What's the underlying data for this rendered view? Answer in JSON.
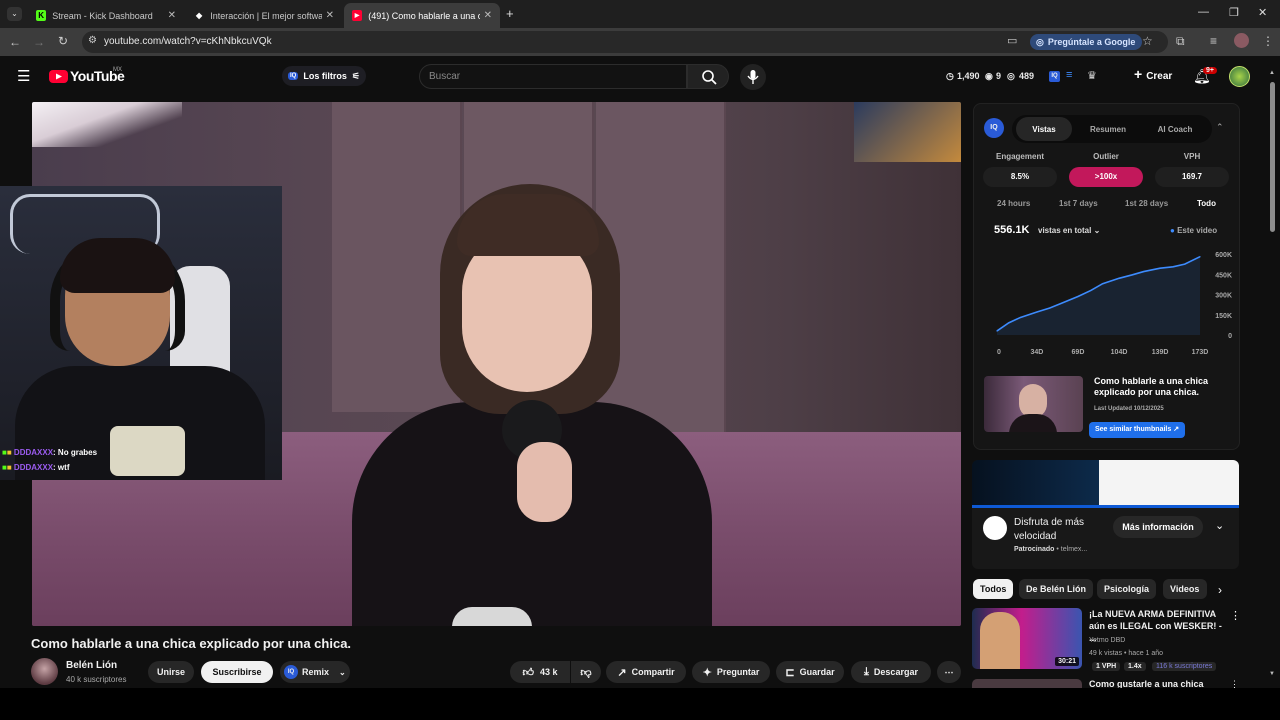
{
  "browser": {
    "tabs": [
      {
        "title": "Stream - Kick Dashboard",
        "favicon": "K",
        "color": "#53fc18",
        "active": false
      },
      {
        "title": "Interacción | El mejor software pa",
        "favicon": "◆",
        "color": "#ffffff",
        "active": false
      },
      {
        "title": "(491) Como hablarle a una chic",
        "favicon": "▶",
        "color": "#ff0033",
        "active": true
      }
    ],
    "url": "youtube.com/watch?v=cKhNbkcuVQk",
    "ask_google": "Pregúntale a Google"
  },
  "youtube": {
    "logo_text": "YouTube",
    "region": "MX",
    "filters_label": "Los filtros",
    "search_placeholder": "Buscar",
    "stats": [
      "1,490",
      "9",
      "489"
    ],
    "create_label": "Crear",
    "notif_count": "9+"
  },
  "video": {
    "title": "Como hablarle a una chica explicado por una chica.",
    "chat": [
      {
        "user": "DDDAXXX",
        "message": ": No grabes"
      },
      {
        "user": "DDDAXXX",
        "message": ": wtf"
      }
    ]
  },
  "channel": {
    "name": "Belén Lión",
    "subscribers": "40 k suscriptores",
    "join_label": "Unirse",
    "subscribe_label": "Suscribirse",
    "remix_label": "Remix"
  },
  "actions": {
    "likes": "43 k",
    "share": "Compartir",
    "ask": "Preguntar",
    "save": "Guardar",
    "download": "Descargar"
  },
  "iq_panel": {
    "tabs": [
      "Vistas",
      "Resumen",
      "AI Coach"
    ],
    "active_tab": "Vistas",
    "metrics": [
      {
        "label": "Engagement",
        "value": "8.5%"
      },
      {
        "label": "Outlier",
        "value": ">100x"
      },
      {
        "label": "VPH",
        "value": "169.7"
      }
    ],
    "ranges": [
      "24 hours",
      "1st 7 days",
      "1st 28 days",
      "Todo"
    ],
    "active_range": "Todo",
    "total_views": "556.1K",
    "views_dropdown": "vistas en total",
    "legend": "Este video",
    "thumb_title": "Como hablarle a una chica explicado por una chica.",
    "last_updated": "Last Updated 10/12/2025",
    "similar_button": "See similar thumbnails"
  },
  "chart_data": {
    "type": "line",
    "x": [
      0,
      10,
      20,
      34,
      45,
      55,
      69,
      80,
      90,
      104,
      115,
      125,
      139,
      150,
      160,
      173
    ],
    "y": [
      30,
      90,
      130,
      170,
      200,
      235,
      285,
      330,
      380,
      420,
      445,
      470,
      495,
      505,
      525,
      580
    ],
    "x_ticks": [
      "0",
      "34D",
      "69D",
      "104D",
      "139D",
      "173D"
    ],
    "y_ticks": [
      "600K",
      "450K",
      "300K",
      "150K",
      "0"
    ],
    "xlim": [
      0,
      173
    ],
    "ylim": [
      0,
      600
    ],
    "series_name": "Este video",
    "color": "#3d8bfd"
  },
  "ad": {
    "title": "Disfruta de más velocidad",
    "sponsored": "Patrocinado",
    "advertiser": "telmex...",
    "cta": "Más información"
  },
  "chips": [
    "Todos",
    "De Belén Lión",
    "Psicología",
    "Videos"
  ],
  "recommendations": [
    {
      "title": "¡La NUEVA ARMA DEFINITIVA aún es ILEGAL con WESKER! - ...",
      "channel": "Yetmo DBD",
      "meta": "49 k vistas • hace 1 año",
      "duration": "30:21",
      "badges": [
        "1 VPH",
        "1.4x",
        "116 k suscriptores"
      ]
    },
    {
      "title": "Como gustarle a una chica"
    }
  ]
}
